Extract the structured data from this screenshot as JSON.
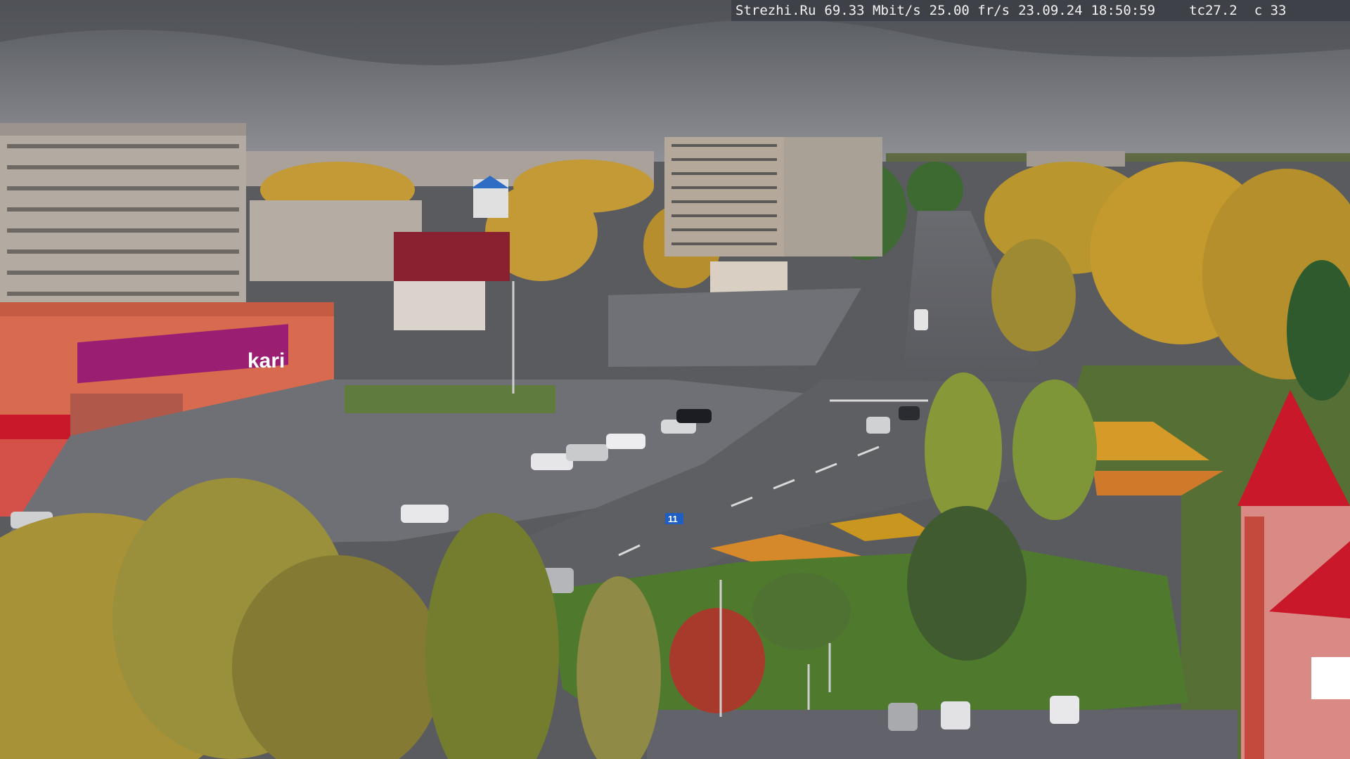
{
  "camera_overlay": {
    "site": "Strezhi.Ru",
    "bitrate": "69.33 Mbit/s",
    "framerate": "25.00 fr/s",
    "date": "23.09.24",
    "time": "18:50:59",
    "temperature_label": "tc27.2",
    "channel_label": "c 33"
  },
  "signs": {
    "store_brand": "kari",
    "road_sign_number": "11"
  },
  "colors": {
    "sky": "#6c6f75",
    "asphalt": "#5f6064",
    "grass": "#4f7a2e",
    "autumn_foliage": "#c99a2e",
    "store_facade": "#d86a4f",
    "store_sign": "#9a1f72",
    "roof_red": "#c8182a",
    "osd_bg": "#3c3e46"
  }
}
